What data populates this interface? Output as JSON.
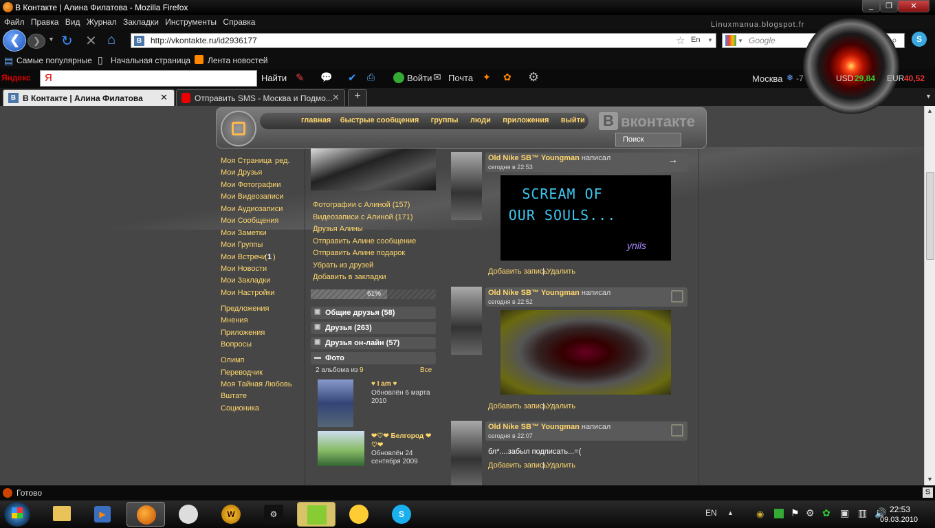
{
  "window": {
    "title": "В Контакте | Алина Филатова - Mozilla Firefox",
    "watermark": "Linuxmanua.blogspot.fr"
  },
  "menu": [
    "Файл",
    "Правка",
    "Вид",
    "Журнал",
    "Закладки",
    "Инструменты",
    "Справка"
  ],
  "url": "http://vkontakte.ru/id2936177",
  "search_placeholder": "Google",
  "url_lang": "En",
  "bookmarks": [
    "Самые популярные",
    "Начальная страница",
    "Лента новостей"
  ],
  "yandex": {
    "logo": "Яндекс",
    "input_value": "Я",
    "find": "Найти",
    "login": "Войти",
    "mail": "Почта",
    "city": "Москва",
    "temp": "-7",
    "weather_score": "1",
    "usd_label": "USD",
    "usd": "29,84",
    "eur_label": "EUR",
    "eur": "40,52"
  },
  "tabs": [
    {
      "label": "В Контакте | Алина Филатова",
      "icon": "В"
    },
    {
      "label": "Отправить SMS - Москва и Подмо..."
    }
  ],
  "status": "Готово",
  "clock": {
    "time": "22:53",
    "date": "09.03.2010",
    "lang": "EN"
  },
  "vk": {
    "logo_text": "вконтакте",
    "logo_b": "В",
    "search_btn": "Поиск",
    "nav": [
      "главная",
      "быстрые сообщения",
      "группы",
      "люди",
      "приложения",
      "выйти"
    ],
    "left_menu_1": [
      {
        "label": "Моя Страница",
        "extra": "ред."
      },
      {
        "label": "Мои Друзья"
      },
      {
        "label": "Мои Фотографии"
      },
      {
        "label": "Мои Видеозаписи"
      },
      {
        "label": "Мои Аудиозаписи"
      },
      {
        "label": "Мои Сообщения"
      },
      {
        "label": "Мои Заметки"
      },
      {
        "label": "Мои Группы"
      },
      {
        "label": "Мои Встречи",
        "count": "1"
      },
      {
        "label": "Мои Новости"
      },
      {
        "label": "Мои Закладки"
      },
      {
        "label": "Мои Настройки"
      }
    ],
    "left_menu_2": [
      "Предложения",
      "Мнения",
      "Приложения",
      "Вопросы"
    ],
    "left_menu_3": [
      "Олимп",
      "Переводчик",
      "Моя Тайная Любовь",
      "Вштате",
      "Соционика"
    ],
    "profile_links": [
      "Фотографии с Алиной (157)",
      "Видеозаписи с Алиной (171)",
      "Друзья Алины",
      "Отправить Алине сообщение",
      "Отправить Алине подарок",
      "Убрать из друзей",
      "Добавить в закладки"
    ],
    "rating": "61%",
    "rating_value": 0.61,
    "blocks": [
      "Общие друзья (58)",
      "Друзья (263)",
      "Друзья он-лайн (57)",
      "Фото"
    ],
    "albums_count": "2 альбома из",
    "albums_total": "9",
    "albums_all": "Все",
    "albums": [
      {
        "title": "♥ I am ♥",
        "updated": "Обновлён 6 марта 2010"
      },
      {
        "title": "❤♡❤ Белгород ❤♡❤",
        "updated": "Обновлён 24 сентября 2009"
      }
    ],
    "wall": [
      {
        "author": "Old Nike SB™ Youngman",
        "wrote": "написал",
        "time": "сегодня в 22:53",
        "image_text": "SCREAM OF OUR SOULS...",
        "image_signature": "ynils",
        "add": "Добавить запись",
        "del": "Удалить"
      },
      {
        "author": "Old Nike SB™ Youngman",
        "wrote": "написал",
        "time": "сегодня в 22:52",
        "add": "Добавить запись",
        "del": "Удалить"
      },
      {
        "author": "Old Nike SB™ Youngman",
        "wrote": "написал",
        "time": "сегодня в 22:07",
        "text": "бл*....забыл подписать...=(",
        "add": "Добавить запись",
        "del": "Удалить"
      }
    ]
  }
}
